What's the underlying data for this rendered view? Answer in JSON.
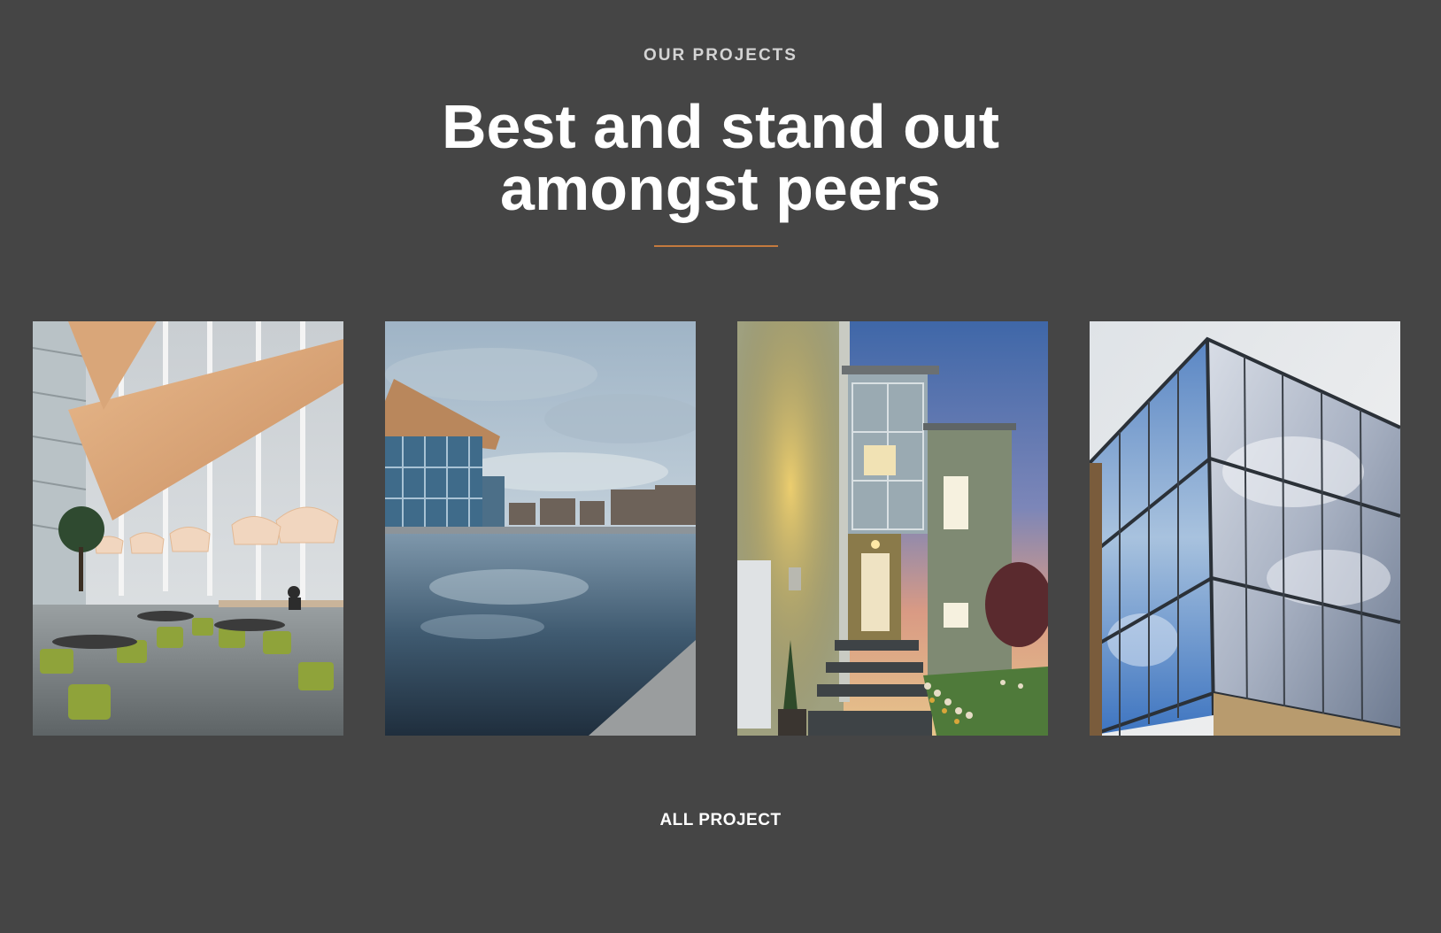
{
  "section": {
    "eyebrow": "OUR PROJECTS",
    "headline_line1": "Best and stand out",
    "headline_line2": "amongst peers",
    "accent_color": "#c47a3e",
    "background_color": "#454545"
  },
  "projects": [
    {
      "subject": "office-cafeteria-interior-photo"
    },
    {
      "subject": "waterfront-glass-building-photo"
    },
    {
      "subject": "modern-house-at-dusk-photo"
    },
    {
      "subject": "glass-facade-building-photo"
    }
  ],
  "cta": {
    "label": "ALL PROJECT"
  }
}
